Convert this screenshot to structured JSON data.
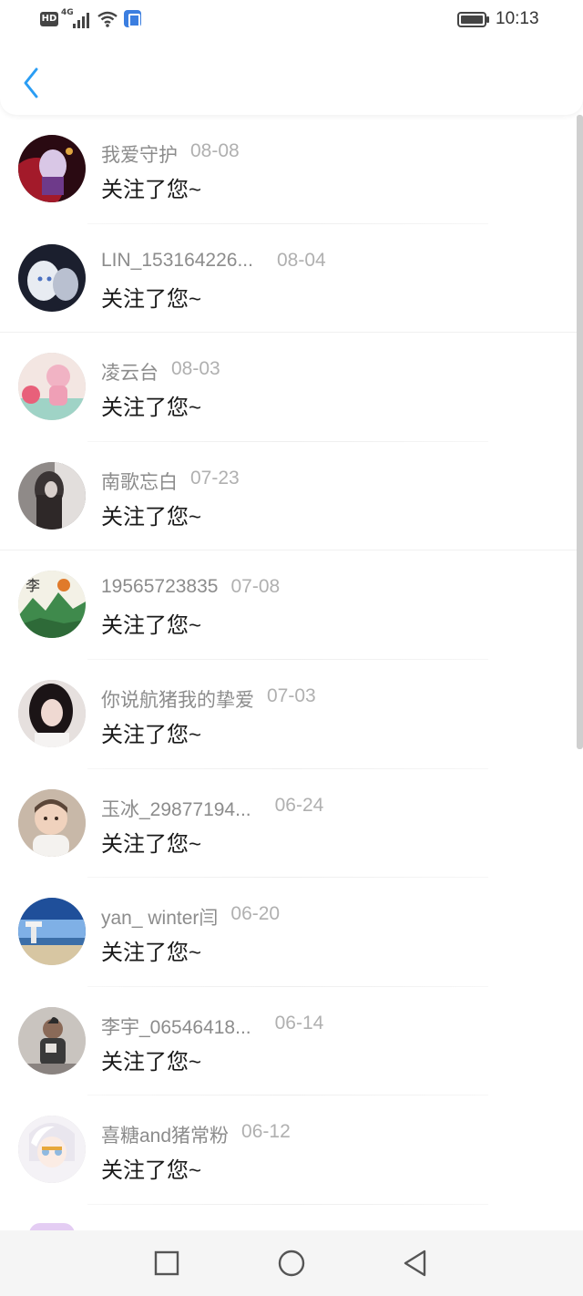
{
  "status_bar": {
    "hd_label": "HD",
    "network_label": "4G",
    "time": "10:13",
    "icons": [
      "signal-icon",
      "wifi-icon",
      "notification-app-icon",
      "battery-icon"
    ]
  },
  "header": {
    "back_icon": "chevron-left-icon",
    "accent_color": "#2a9df4"
  },
  "followers": [
    {
      "name": "我爱守护",
      "date": "08-08",
      "message": "关注了您~",
      "avatar_colors": [
        "#2a0a12",
        "#a31a2a",
        "#d9c7e6"
      ]
    },
    {
      "name": "LIN_153164226...",
      "date": "08-04",
      "message": "关注了您~",
      "avatar_colors": [
        "#1b1f2e",
        "#e8ecf2",
        "#8a92a6"
      ]
    },
    {
      "name": "凌云台",
      "date": "08-03",
      "message": "关注了您~",
      "avatar_colors": [
        "#f3e6e2",
        "#f1b3c4",
        "#9fd3c6"
      ]
    },
    {
      "name": "南歌忘白",
      "date": "07-23",
      "message": "关注了您~",
      "avatar_colors": [
        "#3a3434",
        "#8f8a88",
        "#e2dedc"
      ]
    },
    {
      "name": "19565723835",
      "date": "07-08",
      "message": "关注了您~",
      "avatar_colors": [
        "#f3f1e6",
        "#3f8a4c",
        "#e07a2b"
      ]
    },
    {
      "name": "你说航猪我的挚爱",
      "date": "07-03",
      "message": "关注了您~",
      "avatar_colors": [
        "#1b1416",
        "#efd9d2",
        "#6e4a44"
      ]
    },
    {
      "name": "玉冰_29877194...",
      "date": "06-24",
      "message": "关注了您~",
      "avatar_colors": [
        "#5b4638",
        "#f0d2bd",
        "#c8b8a8"
      ]
    },
    {
      "name": "yan_ winter闫",
      "date": "06-20",
      "message": "关注了您~",
      "avatar_colors": [
        "#1f4f9a",
        "#7fb0e6",
        "#d7c6a2"
      ]
    },
    {
      "name": "李宇_06546418...",
      "date": "06-14",
      "message": "关注了您~",
      "avatar_colors": [
        "#3a3a3a",
        "#c9c4bf",
        "#8a8380"
      ]
    },
    {
      "name": "喜糖and猪常粉",
      "date": "06-12",
      "message": "关注了您~",
      "avatar_colors": [
        "#f4f2f6",
        "#8fb9e0",
        "#e6a73a"
      ]
    }
  ],
  "nav_bar": {
    "buttons": [
      "recents-square-icon",
      "home-circle-icon",
      "back-triangle-icon"
    ]
  }
}
